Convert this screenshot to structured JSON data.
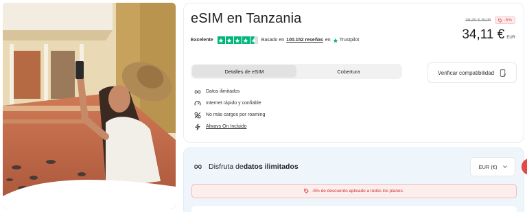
{
  "product": {
    "title": "eSIM en Tanzania",
    "rating_word": "Excelente",
    "rating_stars": 4.5,
    "reviews_prefix": "Basado en",
    "reviews_count": "100.152 reseñas",
    "reviews_suffix": "en",
    "trustpilot": "Trustpilot",
    "price_old": "35,90 € EUR",
    "discount": "-5%",
    "price_new": "34,11 €",
    "currency_code": "EUR"
  },
  "tabs": [
    {
      "label": "Detalles de eSIM",
      "active": true
    },
    {
      "label": "Cobertura",
      "active": false
    }
  ],
  "compat_button": {
    "label": "Verificar compatibilidad",
    "icon": "phone-check-icon"
  },
  "features": [
    {
      "label": "Datos ilimitados",
      "icon": "infinity-icon"
    },
    {
      "label": "Internet rápido y confiable",
      "icon": "speedometer-icon"
    },
    {
      "label": "No más cargos por roaming",
      "icon": "no-roaming-icon"
    },
    {
      "label": "Always On Incluido",
      "icon": "lightning-icon"
    }
  ],
  "plans": {
    "heading_pre": "Disfruta de ",
    "heading_bold": "datos ilimitados",
    "currency_select": "EUR (€)",
    "discount_notice": "-5% de descuento aplicado a todos los planes."
  },
  "colors": {
    "trustpilot_green": "#00b67a",
    "discount_red": "#d9534f",
    "plans_bg": "#eef6fb"
  }
}
